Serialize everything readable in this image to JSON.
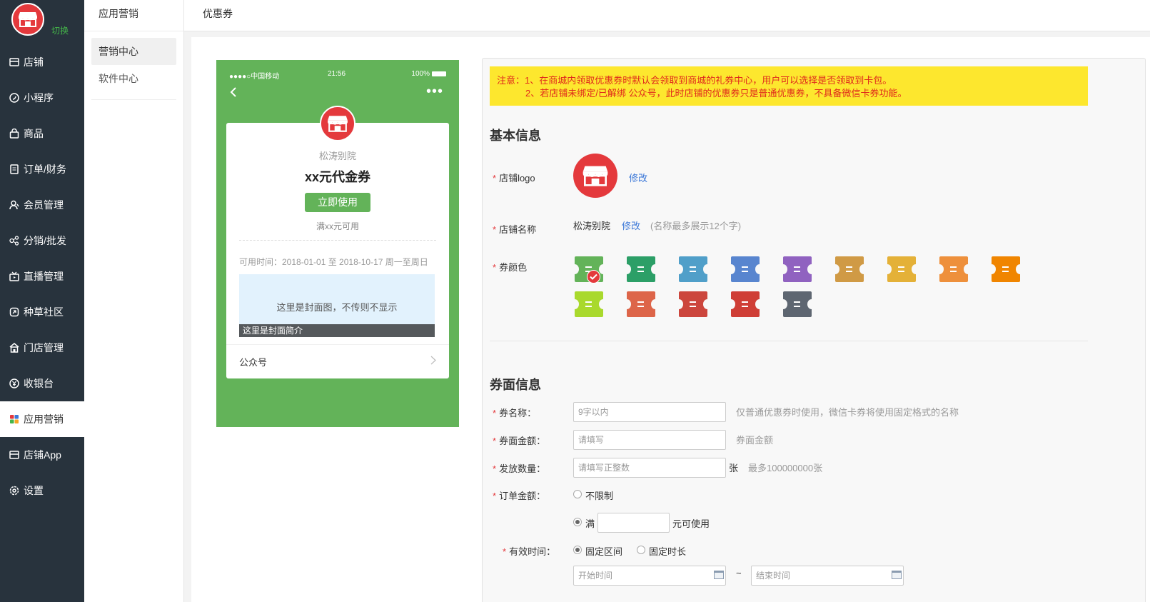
{
  "sidebar": {
    "switch_label": "切换",
    "items": [
      {
        "label": "店铺",
        "icon": "shop-icon"
      },
      {
        "label": "小程序",
        "icon": "mini-program-icon"
      },
      {
        "label": "商品",
        "icon": "product-bag-icon"
      },
      {
        "label": "订单/财务",
        "icon": "order-list-icon"
      },
      {
        "label": "会员管理",
        "icon": "member-icon"
      },
      {
        "label": "分销/批发",
        "icon": "distribution-icon"
      },
      {
        "label": "直播管理",
        "icon": "live-icon"
      },
      {
        "label": "种草社区",
        "icon": "community-icon"
      },
      {
        "label": "门店管理",
        "icon": "store-icon"
      },
      {
        "label": "收银台",
        "icon": "cashier-icon"
      },
      {
        "label": "应用营销",
        "icon": "app-grid-icon",
        "active": true
      },
      {
        "label": "店铺App",
        "icon": "shop-app-icon"
      },
      {
        "label": "设置",
        "icon": "settings-gear-icon"
      }
    ]
  },
  "submenu": {
    "title": "应用营销",
    "items": [
      {
        "label": "营销中心",
        "active": true
      },
      {
        "label": "软件中心"
      }
    ]
  },
  "topbar": {
    "title": "优惠券"
  },
  "preview": {
    "carrier": "●●●●○中国移动",
    "time": "21:56",
    "battery": "100%",
    "shop_name": "松涛别院",
    "coupon_title": "xx元代金券",
    "use_button": "立即使用",
    "condition": "满xx元可用",
    "valid_time": "可用时间：2018-01-01 至 2018-10-17 周一至周日",
    "cover_text": "这里是封面图，不传则不显示",
    "cover_caption": "这里是封面简介",
    "row_label": "公众号",
    "bg_color": "#63b359"
  },
  "form": {
    "notice_line1": "注意：1、在商城内领取优惠券时默认会领取到商城的礼券中心，用户可以选择是否领取到卡包。",
    "notice_line2": "2、若店铺未绑定/已解绑 公众号，此时店铺的优惠券只是普通优惠券，不具备微信卡券功能。",
    "basic_title": "基本信息",
    "logo_label": "店铺logo",
    "logo_edit": "修改",
    "name_label": "店铺名称",
    "name_value": "松涛别院",
    "name_edit": "修改",
    "name_hint": "(名称最多展示12个字)",
    "color_label": "券颜色",
    "colors": [
      "#63b359",
      "#2c9f67",
      "#509fc9",
      "#5885cf",
      "#9062c0",
      "#d09a45",
      "#e4b138",
      "#ee903c",
      "#f08500",
      "#a9d92d",
      "#dd6549",
      "#cc463d",
      "#cf3e36",
      "#5e6671"
    ],
    "selected_color": "#63b359",
    "face_title": "券面信息",
    "coupon_name_label": "券名称：",
    "coupon_name_placeholder": "9字以内",
    "coupon_name_hint": "仅普通优惠券时使用，微信卡券将使用固定格式的名称",
    "amount_label": "券面金额：",
    "amount_placeholder": "请填写",
    "amount_hint": "券面金额",
    "quantity_label": "发放数量：",
    "quantity_placeholder": "请填写正整数",
    "quantity_unit": "张",
    "quantity_hint": "最多100000000张",
    "order_label": "订单金额：",
    "order_unlimited": "不限制",
    "order_full": "满",
    "order_full_suffix": "元可使用",
    "order_full_value": "",
    "valid_label": "有效时间：",
    "valid_fixed_range": "固定区间",
    "valid_fixed_length": "固定时长",
    "start_placeholder": "开始时间",
    "tilde": "~",
    "end_placeholder": "结束时间"
  }
}
